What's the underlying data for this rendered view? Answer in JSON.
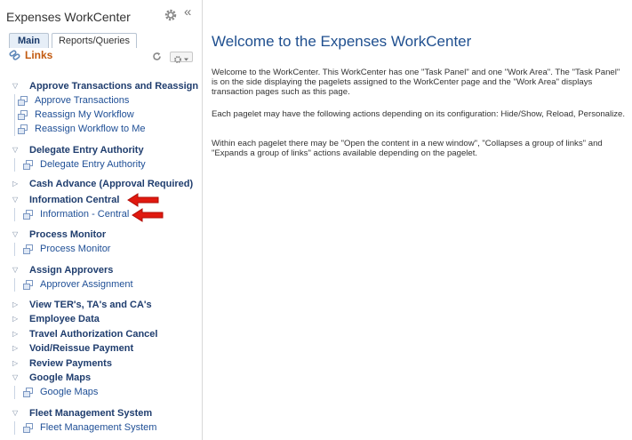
{
  "panel": {
    "title": "Expenses WorkCenter",
    "tabs": [
      "Main",
      "Reports/Queries"
    ],
    "links_title": "Links"
  },
  "groups": [
    {
      "label": "Approve Transactions and Reassign",
      "expanded": true,
      "items": [
        "Approve Transactions",
        "Reassign My Workflow",
        "Reassign Workflow to Me"
      ]
    },
    {
      "label": "Delegate Entry Authority",
      "expanded": true,
      "items": [
        "Delegate Entry Authority"
      ]
    },
    {
      "label": "Cash Advance (Approval Required)",
      "expanded": false,
      "items": []
    },
    {
      "label": "Information Central",
      "expanded": true,
      "items": [
        "Information - Central"
      ]
    },
    {
      "label": "Process Monitor",
      "expanded": true,
      "items": [
        "Process Monitor"
      ]
    },
    {
      "label": "Assign Approvers",
      "expanded": true,
      "items": [
        "Approver Assignment"
      ]
    },
    {
      "label": "View TER's, TA's and CA's",
      "expanded": false,
      "items": []
    },
    {
      "label": "Employee Data",
      "expanded": false,
      "items": []
    },
    {
      "label": "Travel Authorization Cancel",
      "expanded": false,
      "items": []
    },
    {
      "label": "Void/Reissue Payment",
      "expanded": false,
      "items": []
    },
    {
      "label": "Review Payments",
      "expanded": false,
      "items": []
    },
    {
      "label": "Google Maps",
      "expanded": true,
      "items": [
        "Google Maps"
      ]
    },
    {
      "label": "Fleet Management System",
      "expanded": true,
      "items": [
        "Fleet Management System"
      ]
    }
  ],
  "work_area": {
    "title": "Welcome to the Expenses WorkCenter",
    "paragraphs": [
      "Welcome to the WorkCenter. This WorkCenter has one \"Task Panel\" and one \"Work Area\". The \"Task Panel\" is on the side displaying the pagelets assigned to the WorkCenter page and the \"Work Area\" displays transaction pages such as this page.",
      "Each pagelet may have the following actions depending on its configuration: Hide/Show, Reload, Personalize.",
      "Within each pagelet there may be \"Open the content in a new window\", \"Collapses a group of links\" and \"Expands a group of links\" actions available depending on the pagelet."
    ]
  },
  "colors": {
    "header_link": "#1f3d6e",
    "link": "#1f4f96",
    "links_title": "#c25a10",
    "annotation_arrow": "#e0190f"
  }
}
